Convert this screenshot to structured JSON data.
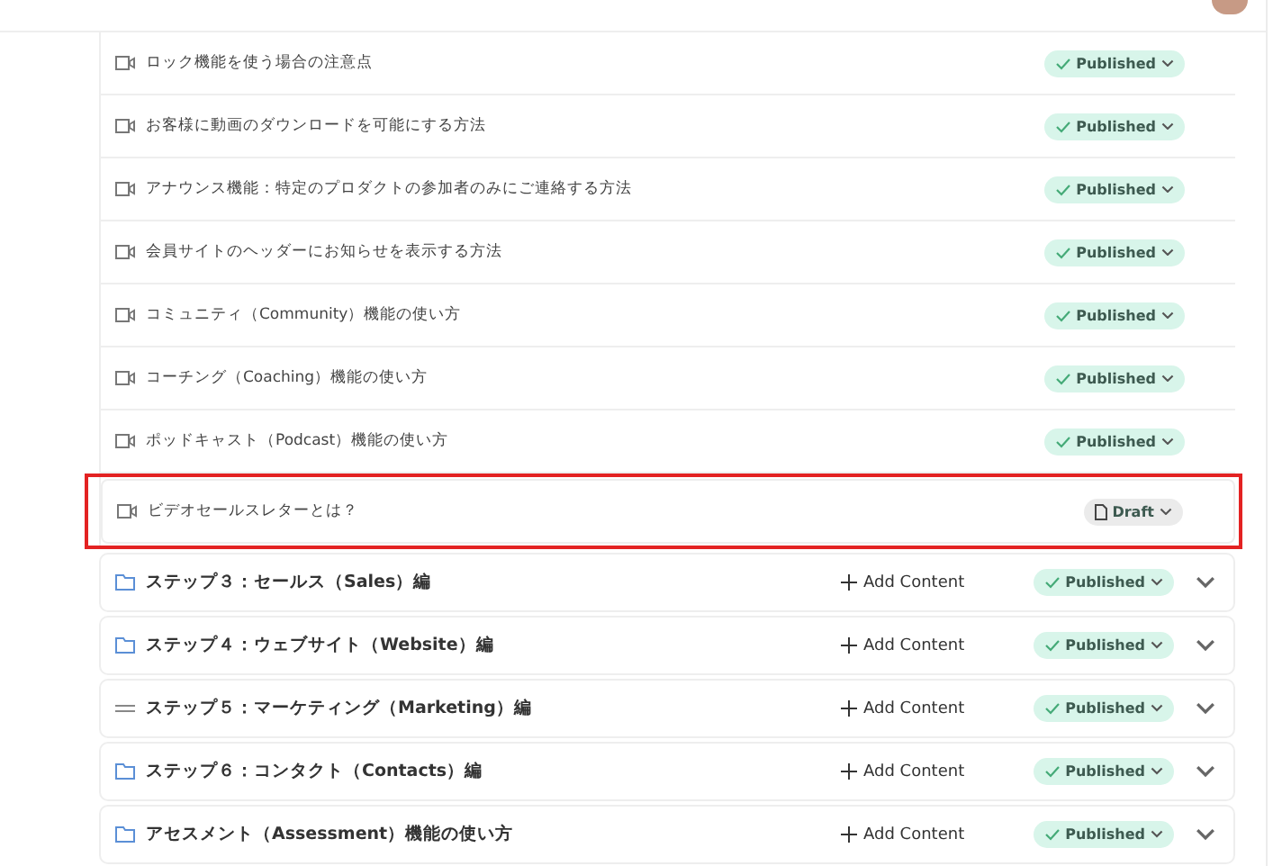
{
  "lessons": [
    {
      "title": "ロック機能を使う場合の注意点",
      "status": {
        "kind": "published",
        "label": "Published"
      },
      "highlighted": false
    },
    {
      "title": "お客様に動画のダウンロードを可能にする方法",
      "status": {
        "kind": "published",
        "label": "Published"
      },
      "highlighted": false
    },
    {
      "title": "アナウンス機能：特定のプロダクトの参加者のみにご連絡する方法",
      "status": {
        "kind": "published",
        "label": "Published"
      },
      "highlighted": false
    },
    {
      "title": "会員サイトのヘッダーにお知らせを表示する方法",
      "status": {
        "kind": "published",
        "label": "Published"
      },
      "highlighted": false
    },
    {
      "title": "コミュニティ（Community）機能の使い方",
      "status": {
        "kind": "published",
        "label": "Published"
      },
      "highlighted": false
    },
    {
      "title": "コーチング（Coaching）機能の使い方",
      "status": {
        "kind": "published",
        "label": "Published"
      },
      "highlighted": false
    },
    {
      "title": "ポッドキャスト（Podcast）機能の使い方",
      "status": {
        "kind": "published",
        "label": "Published"
      },
      "highlighted": false
    },
    {
      "title": "ビデオセールスレターとは？",
      "status": {
        "kind": "draft",
        "label": "Draft"
      },
      "highlighted": true
    }
  ],
  "sections": [
    {
      "title": "ステップ３：セールス（Sales）編",
      "kind": "folder",
      "add_label": "Add Content",
      "status": {
        "kind": "published",
        "label": "Published"
      }
    },
    {
      "title": "ステップ４：ウェブサイト（Website）編",
      "kind": "folder",
      "add_label": "Add Content",
      "status": {
        "kind": "published",
        "label": "Published"
      }
    },
    {
      "title": "ステップ５：マーケティング（Marketing）編",
      "kind": "drag",
      "add_label": "Add Content",
      "status": {
        "kind": "published",
        "label": "Published"
      }
    },
    {
      "title": "ステップ６：コンタクト（Contacts）編",
      "kind": "folder",
      "add_label": "Add Content",
      "status": {
        "kind": "published",
        "label": "Published"
      }
    },
    {
      "title": "アセスメント（Assessment）機能の使い方",
      "kind": "folder",
      "add_label": "Add Content",
      "status": {
        "kind": "published",
        "label": "Published"
      }
    }
  ]
}
